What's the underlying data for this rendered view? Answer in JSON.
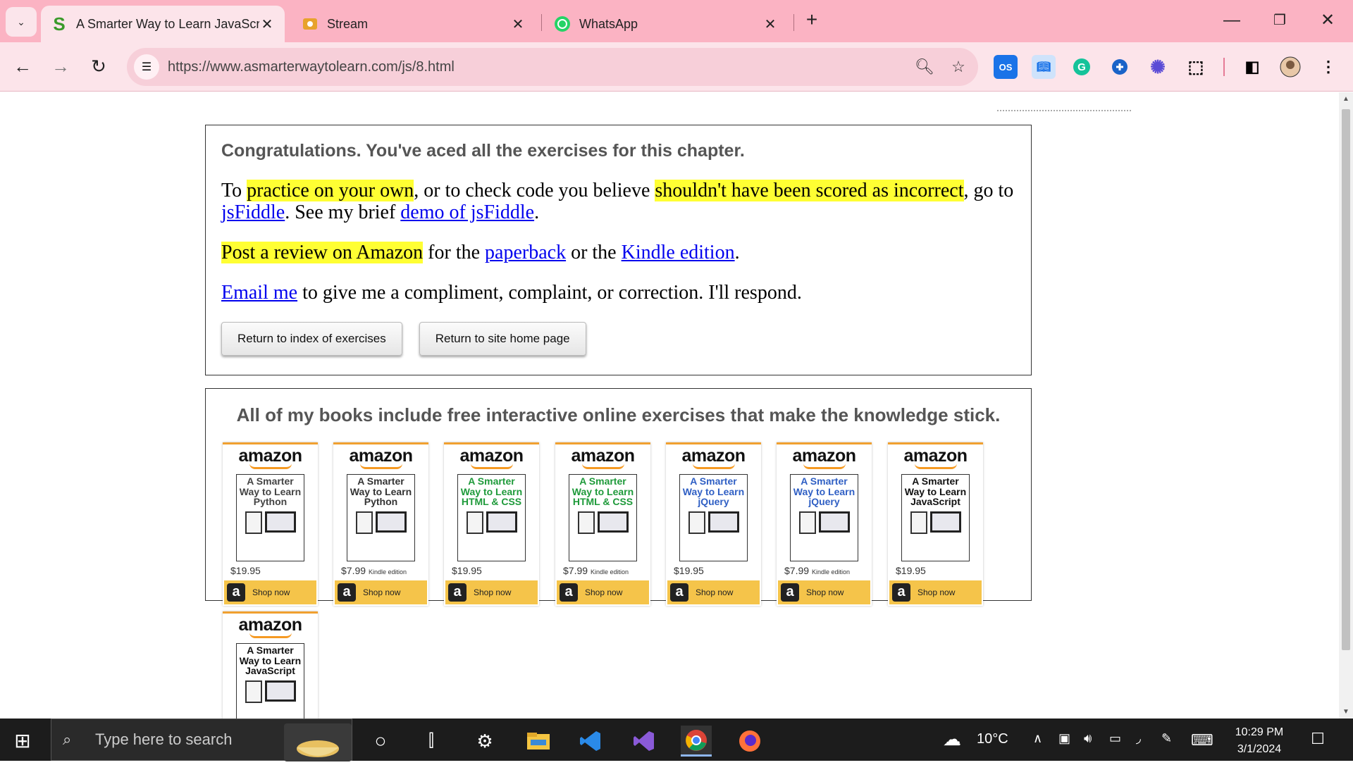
{
  "browser": {
    "tabs": [
      {
        "title": "A Smarter Way to Learn JavaScr",
        "favicon": "S"
      },
      {
        "title": "Stream",
        "favicon": "stream-icon"
      },
      {
        "title": "WhatsApp",
        "favicon": "whatsapp-icon"
      }
    ],
    "url": "https://www.asmarterwaytolearn.com/js/8.html",
    "extensions": [
      "OS",
      "translate",
      "grammarly",
      "puzzle",
      "star",
      "extensions"
    ]
  },
  "page": {
    "congrats": "Congratulations. You've aced all the exercises for this chapter.",
    "p1": {
      "t1": "To ",
      "hl1": "practice on your own",
      "t2": ", or to check code you believe ",
      "hl2": "shouldn't have been scored as incorrect",
      "t3": ", go to ",
      "link1": "jsFiddle",
      "t4": ". See my brief ",
      "link2": "demo of jsFiddle",
      "t5": "."
    },
    "p2": {
      "hl": "Post a review on Amazon",
      "t1": " for the ",
      "link1": "paperback",
      "t2": " or the ",
      "link2": "Kindle edition",
      "t3": "."
    },
    "p3": {
      "link": "Email me",
      "t1": " to give me a compliment, complaint, or correction. I'll respond."
    },
    "buttons": {
      "index": "Return to index of exercises",
      "home": "Return to site home page"
    },
    "books_heading": "All of my books include free interactive online exercises that make the knowledge stick.",
    "books": [
      {
        "brand": "amazon",
        "title": "A Smarter Way to Learn Python",
        "color": "#444444",
        "price": "$19.95",
        "edition": "",
        "shop": "Shop now"
      },
      {
        "brand": "amazon",
        "title": "A Smarter Way to Learn Python",
        "color": "#333333",
        "price": "$7.99",
        "edition": "Kindle edition",
        "shop": "Shop now"
      },
      {
        "brand": "amazon",
        "title": "A Smarter Way to Learn HTML & CSS",
        "color": "#1e9a3a",
        "price": "$19.95",
        "edition": "",
        "shop": "Shop now"
      },
      {
        "brand": "amazon",
        "title": "A Smarter Way to Learn HTML & CSS",
        "color": "#1e9a3a",
        "price": "$7.99",
        "edition": "Kindle edition",
        "shop": "Shop now"
      },
      {
        "brand": "amazon",
        "title": "A Smarter Way to Learn jQuery",
        "color": "#2f5fc4",
        "price": "$19.95",
        "edition": "",
        "shop": "Shop now"
      },
      {
        "brand": "amazon",
        "title": "A Smarter Way to Learn jQuery",
        "color": "#2f5fc4",
        "price": "$7.99",
        "edition": "Kindle edition",
        "shop": "Shop now"
      },
      {
        "brand": "amazon",
        "title": "A Smarter Way to Learn JavaScript",
        "color": "#111111",
        "price": "$19.95",
        "edition": "",
        "shop": "Shop now"
      },
      {
        "brand": "amazon",
        "title": "A Smarter Way to Learn JavaScript",
        "color": "#111111",
        "price": "",
        "edition": "",
        "shop": ""
      }
    ]
  },
  "taskbar": {
    "search_placeholder": "Type here to search",
    "weather": "10°C",
    "time": "10:29 PM",
    "date": "3/1/2024"
  }
}
